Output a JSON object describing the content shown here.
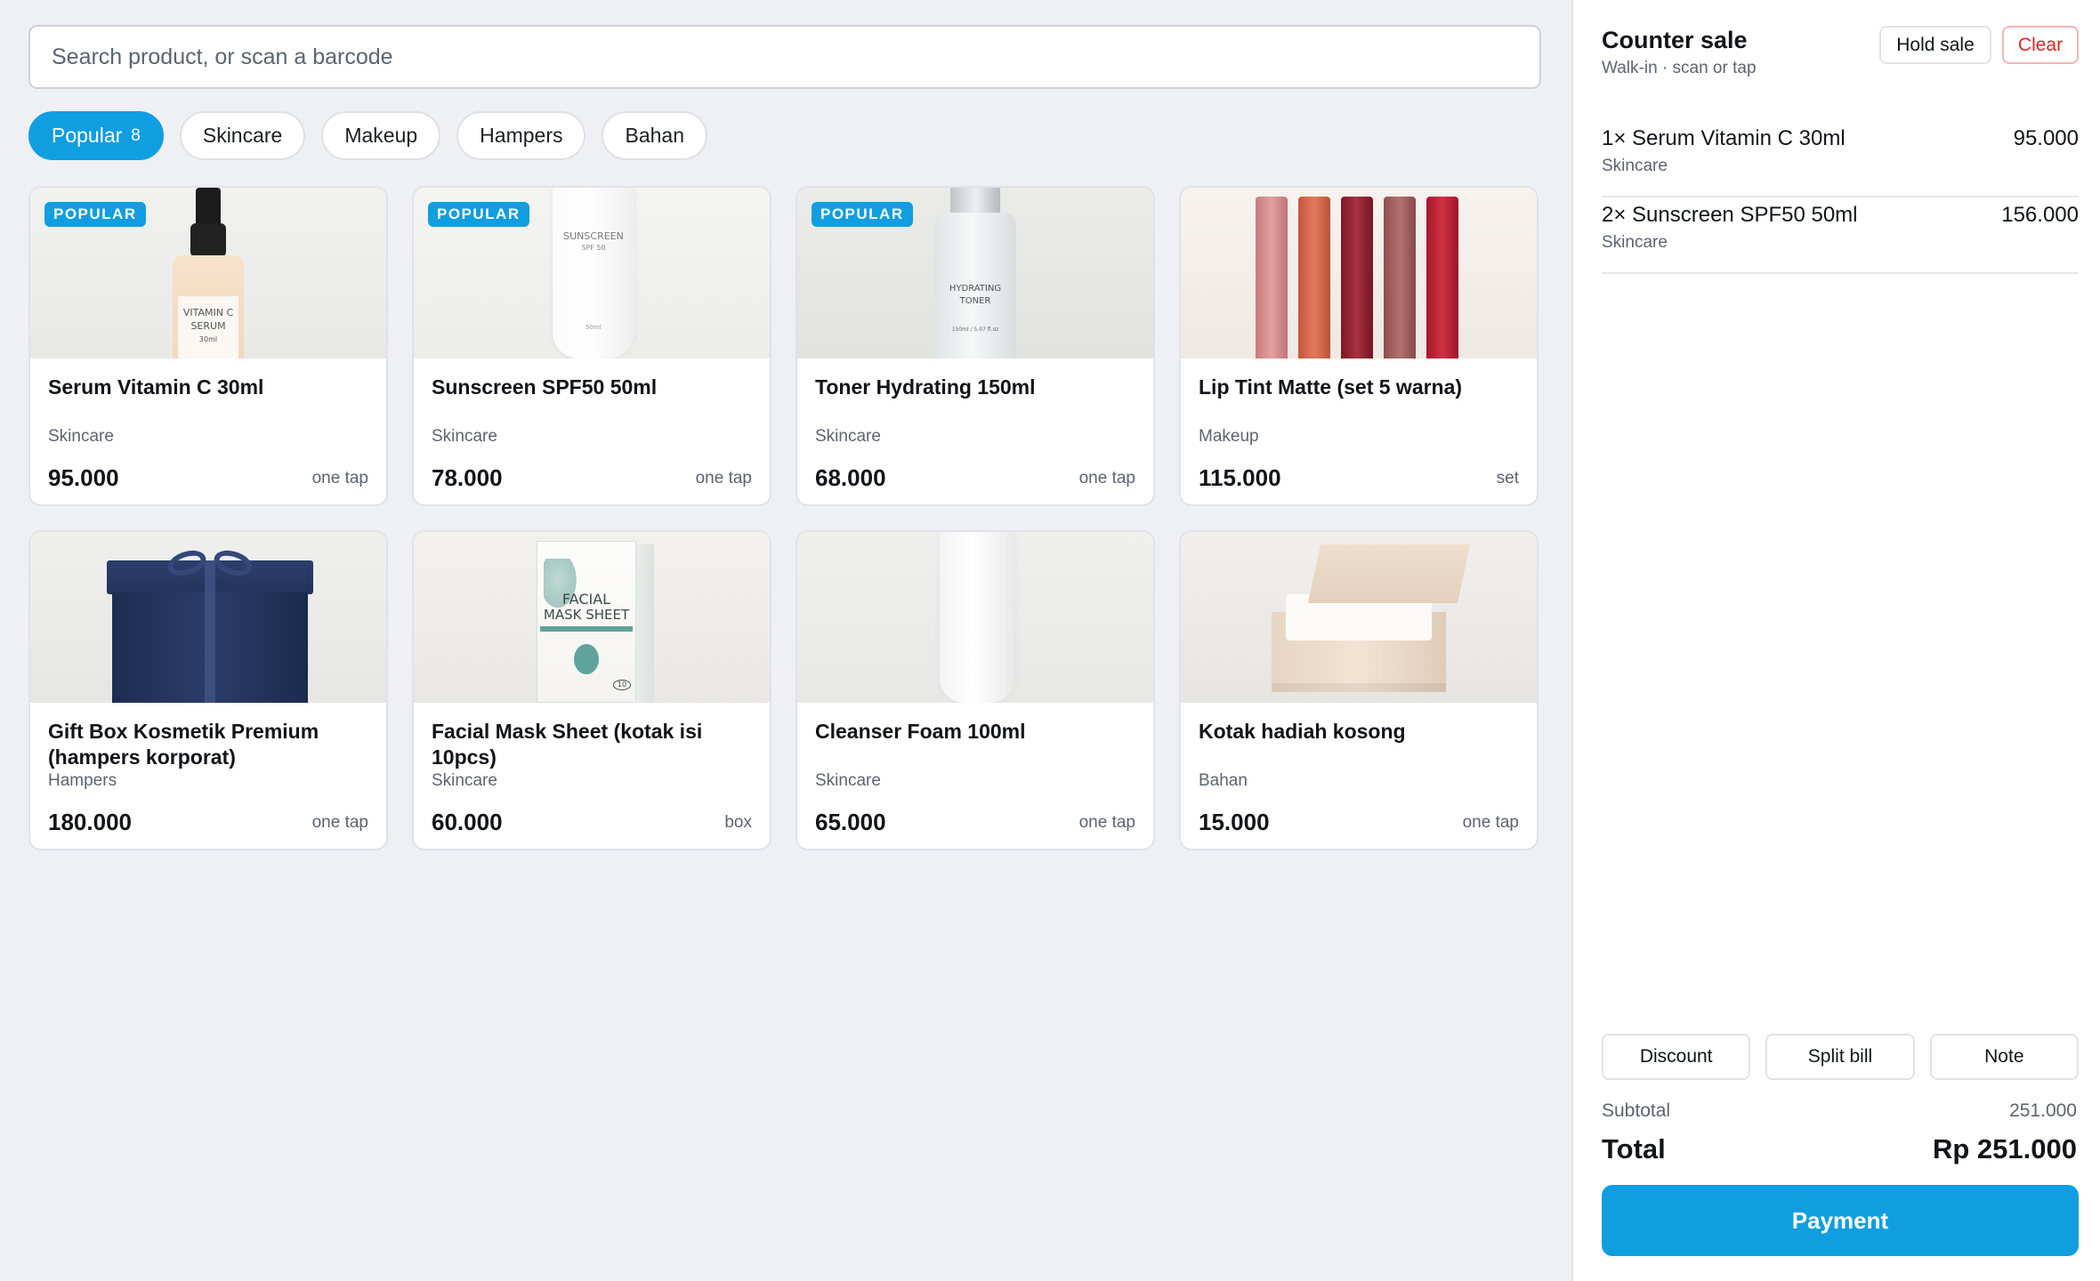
{
  "search": {
    "placeholder": "Search product, or scan a barcode",
    "value": ""
  },
  "categories": [
    {
      "label": "Popular",
      "count": "8",
      "active": true
    },
    {
      "label": "Skincare"
    },
    {
      "label": "Makeup"
    },
    {
      "label": "Hampers"
    },
    {
      "label": "Bahan"
    }
  ],
  "badge_text": "POPULAR",
  "products": [
    {
      "name": "Serum Vitamin C 30ml",
      "category": "Skincare",
      "price": "95.000",
      "unit": "one tap",
      "badge": true,
      "image_text": [
        "VITAMIN C",
        "SERUM",
        "30ml"
      ]
    },
    {
      "name": "Sunscreen SPF50 50ml",
      "category": "Skincare",
      "price": "78.000",
      "unit": "one tap",
      "badge": true,
      "image_text": [
        "SUNSCREEN",
        "SPF 50",
        "50ml"
      ]
    },
    {
      "name": "Toner Hydrating 150ml",
      "category": "Skincare",
      "price": "68.000",
      "unit": "one tap",
      "badge": true,
      "image_text": [
        "HYDRATING",
        "TONER",
        "150ml / 5.07 fl.oz"
      ]
    },
    {
      "name": "Lip Tint Matte (set 5 warna)",
      "category": "Makeup",
      "price": "115.000",
      "unit": "set",
      "badge": false
    },
    {
      "name": "Gift Box Kosmetik Premium (hampers korporat)",
      "category": "Hampers",
      "price": "180.000",
      "unit": "one tap",
      "badge": false
    },
    {
      "name": "Facial Mask Sheet (kotak isi 10pcs)",
      "category": "Skincare",
      "price": "60.000",
      "unit": "box",
      "badge": false,
      "image_text": [
        "FACIAL",
        "MASK SHEET",
        "10"
      ]
    },
    {
      "name": "Cleanser Foam 100ml",
      "category": "Skincare",
      "price": "65.000",
      "unit": "one tap",
      "badge": false
    },
    {
      "name": "Kotak hadiah kosong",
      "category": "Bahan",
      "price": "15.000",
      "unit": "one tap",
      "badge": false
    }
  ],
  "cart": {
    "title": "Counter sale",
    "subtitle": "Walk-in · scan or tap",
    "hold_label": "Hold sale",
    "clear_label": "Clear",
    "items": [
      {
        "name": "1× Serum Vitamin C 30ml",
        "category": "Skincare",
        "amount": "95.000"
      },
      {
        "name": "2× Sunscreen SPF50 50ml",
        "category": "Skincare",
        "amount": "156.000"
      }
    ],
    "actions": {
      "discount": "Discount",
      "split": "Split bill",
      "note": "Note"
    },
    "subtotal_label": "Subtotal",
    "subtotal_value": "251.000",
    "total_label": "Total",
    "total_value": "Rp 251.000",
    "payment_label": "Payment"
  },
  "colors": {
    "accent": "#109ee0",
    "danger": "#e02424",
    "background": "#eef0f3",
    "lip_shades": [
      "#d98c8c",
      "#cf5f45",
      "#8e1f2c",
      "#9c5a57",
      "#b81c2c"
    ]
  }
}
